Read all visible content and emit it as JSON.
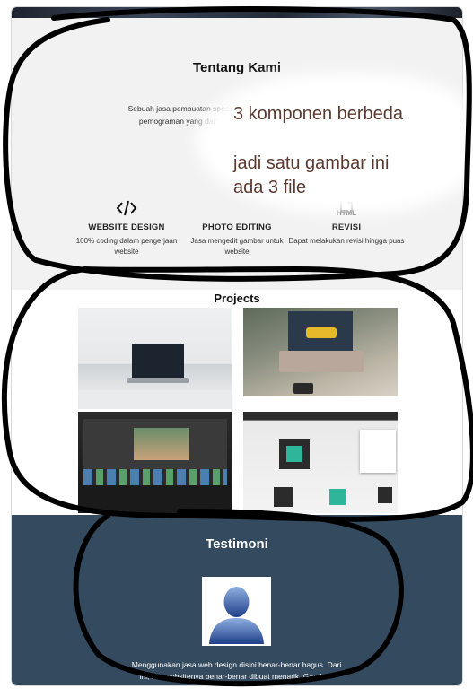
{
  "about": {
    "title": "Tentang Kami",
    "text": "Sebuah jasa pembuatan spesial untuk anda elegan, dan dibuat d pemograman yang dapa perkembangan waktu dalam men"
  },
  "services": [
    {
      "icon": "code-icon",
      "name": "WEBSITE DESIGN",
      "desc": "100% coding dalam pengerjaan website"
    },
    {
      "icon": "photo-icon",
      "name": "PHOTO EDITING",
      "desc": "Jasa mengedit gambar untuk website"
    },
    {
      "icon": "html-file-icon",
      "icon_text": "HTML",
      "name": "REVISI",
      "desc": "Dapat melakukan revisi hingga puas"
    }
  ],
  "projects": {
    "title": "Projects"
  },
  "testimoni": {
    "title": "Testimoni",
    "text": "Menggunakan jasa web design disini benar-benar bagus. Dari ini, kini websitenya benar-benar dibuat menarik. Gambar-"
  },
  "annotation": {
    "line1": "3 komponen berbeda",
    "line2": "jadi satu gambar ini",
    "line3": "ada 3 file",
    "stroke_color": "#000000"
  },
  "colors": {
    "testimoni_bg": "#344a5f",
    "about_bg": "#f2f2f2"
  }
}
